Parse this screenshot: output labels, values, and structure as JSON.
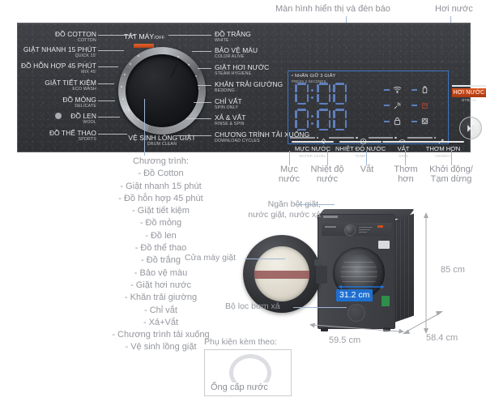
{
  "top_annotations": [
    {
      "label": "Màn hình hiển thị và đèn báo"
    },
    {
      "label": "Hơi nước"
    }
  ],
  "bottom_annotations": [
    {
      "label_line1": "Mực",
      "label_line2": "nước"
    },
    {
      "label_line1": "Nhiệt độ",
      "label_line2": "nước"
    },
    {
      "label_line1": "Vắt",
      "label_line2": ""
    },
    {
      "label_line1": "Thơm",
      "label_line2": "hơn"
    },
    {
      "label_line1": "Khởi động/",
      "label_line2": "Tạm dừng"
    }
  ],
  "panel": {
    "knob": {
      "off_vn": "TẮT MÁY",
      "off_en": "/OFF",
      "bottom_vn": "VỆ SINH LÒNG GIẶT",
      "bottom_en": "DRUM CLEAN"
    },
    "programs_left": [
      {
        "vn": "ĐỒ COTTON",
        "en": "COTTON"
      },
      {
        "vn": "GIẶT NHANH 15 PHÚT",
        "en": "QUICK 15'"
      },
      {
        "vn": "ĐỒ HỖN HỢP 45 PHÚT",
        "en": "MIX 45'"
      },
      {
        "vn": "GIẶT TIẾT KIỆM",
        "en": "ECO WASH"
      },
      {
        "vn": "ĐỒ MỎNG",
        "en": "DELICATE"
      },
      {
        "vn": "ĐỒ LEN",
        "en": "WOOL"
      },
      {
        "vn": "ĐỒ THỂ THAO",
        "en": "SPORTS"
      }
    ],
    "programs_right": [
      {
        "vn": "ĐỒ TRẮNG",
        "en": "WHITE"
      },
      {
        "vn": "BẢO VỆ MÀU",
        "en": "COLOR ALIVE"
      },
      {
        "vn": "GIẶT HƠI NƯỚC",
        "en": "STEAM HYGIENE"
      },
      {
        "vn": "KHĂN TRẢI GIƯỜNG",
        "en": "BEDDING"
      },
      {
        "vn": "CHỈ VẮT",
        "en": "SPIN ONLY"
      },
      {
        "vn": "XẢ & VẮT",
        "en": "RINSE & SPIN"
      },
      {
        "vn": "CHƯƠNG TRÌNH TẢI XUỐNG",
        "en": "DOWNLOAD CYCLES"
      }
    ],
    "display": {
      "press_hold_vn": "• NHẤN GIỮ 3 GIÂY",
      "press_hold_en": "PRESS 3 SECONDS",
      "digits_top": "0:00",
      "digits_bottom": "0:00",
      "indicators": [
        {
          "icon": "wifi-icon"
        },
        {
          "icon": "sensor-icon"
        },
        {
          "icon": "child-lock-icon"
        },
        {
          "icon": "detergent-bottle-icon"
        },
        {
          "icon": "softener-icon"
        },
        {
          "icon": "drum-clean-icon"
        }
      ],
      "sliders": [
        {
          "icon": "water-level-icon"
        },
        {
          "icon": "temperature-icon"
        },
        {
          "icon": "spin-icon"
        },
        {
          "icon": "aroma-icon"
        }
      ]
    },
    "buttons": [
      {
        "vn": "MỰC NƯỚC",
        "en": "WATER LEVEL"
      },
      {
        "vn": "NHIỆT ĐỘ NƯỚC",
        "en": "TEMP"
      },
      {
        "vn": "VẮT",
        "en": "SPIN"
      },
      {
        "vn": "THƠM HƠN",
        "en": "AROMA+"
      }
    ],
    "steam_button": {
      "vn": "HƠI NƯỚC",
      "en": "STEAM",
      "color": "#c8501e"
    },
    "start_button": {
      "name": "Khởi động/Tạm dừng"
    }
  },
  "program_list": {
    "title": "Chương trình:",
    "items": [
      "- Đồ Cotton",
      "- Giặt nhanh 15 phút",
      "- Đồ hỗn hợp 45 phút",
      "- Giặt tiết kiệm",
      "- Đồ mỏng",
      "- Đồ len",
      "- Đồ thể thao",
      "- Đồ trắng",
      "- Bảo vệ màu",
      "- Giặt hơi nước",
      "- Khăn trải giường",
      "- Chỉ vắt",
      "- Xả+Vắt",
      "- Chương trình tải xuống",
      "- Vệ sinh lồng giặt"
    ]
  },
  "machine_callouts": {
    "detergent_drawer_line1": "Ngăn bột giặt,",
    "detergent_drawer_line2": "nước giặt, nước xả",
    "door": "Cửa máy giặt",
    "drain_filter": "Bộ lọc bơm xả"
  },
  "dimensions": {
    "drum_diameter": "31.2 cm",
    "height": "85 cm",
    "width": "59.5 cm",
    "depth": "58.4 cm",
    "badge_color": "#1f6fd0"
  },
  "accessory": {
    "title": "Phụ kiện kèm theo:",
    "item_label": "Ống cấp nước"
  }
}
